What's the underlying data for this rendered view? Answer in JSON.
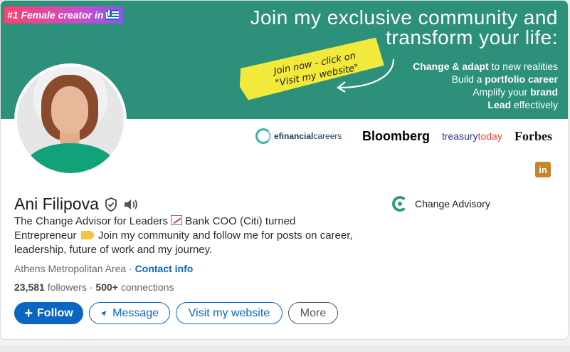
{
  "banner": {
    "badge": "#1 Female creator in",
    "badge_icon": "greek-flag-icon",
    "hero_line1": "Join my exclusive community  and",
    "hero_line2": "transform your life:",
    "cta_line1": "Join now - click on",
    "cta_line2": "\"Visit my website\"",
    "benefits": [
      {
        "strong": "Change & adapt",
        "rest": " to new realities"
      },
      {
        "prefix": "Build a ",
        "strong": "portfolio career",
        "rest": ""
      },
      {
        "prefix": "Amplify your ",
        "strong": "brand",
        "rest": ""
      },
      {
        "strong": "Lead",
        "rest": " effectively"
      }
    ],
    "colors": {
      "banner": "#2c907a",
      "cta": "#f2ea3a"
    }
  },
  "logos": {
    "efin_bold": "efinancial",
    "efin_rest": "careers",
    "bloomberg": "Bloomberg",
    "treasury_a": "treasury",
    "treasury_b": "today",
    "forbes": "Forbes"
  },
  "linkedin_icon": "in",
  "profile": {
    "name": "Ani Filipova",
    "verified_icon": "verified-shield-icon",
    "pronounce_icon": "speaker-icon",
    "headline_a": "The Change Advisor for Leaders ",
    "headline_b": " Bank COO (Citi) turned Entrepreneur ",
    "headline_c": " Join my community and follow me for posts on career, leadership, future of work and my journey.",
    "company": "Change Advisory",
    "location": "Athens Metropolitan Area",
    "separator": " · ",
    "contact_info": "Contact info",
    "followers_count": "23,581",
    "followers_label": " followers",
    "dot": " · ",
    "connections_count": "500+",
    "connections_label": " connections"
  },
  "actions": {
    "follow": "Follow",
    "message": "Message",
    "website": "Visit my website",
    "more": "More"
  }
}
